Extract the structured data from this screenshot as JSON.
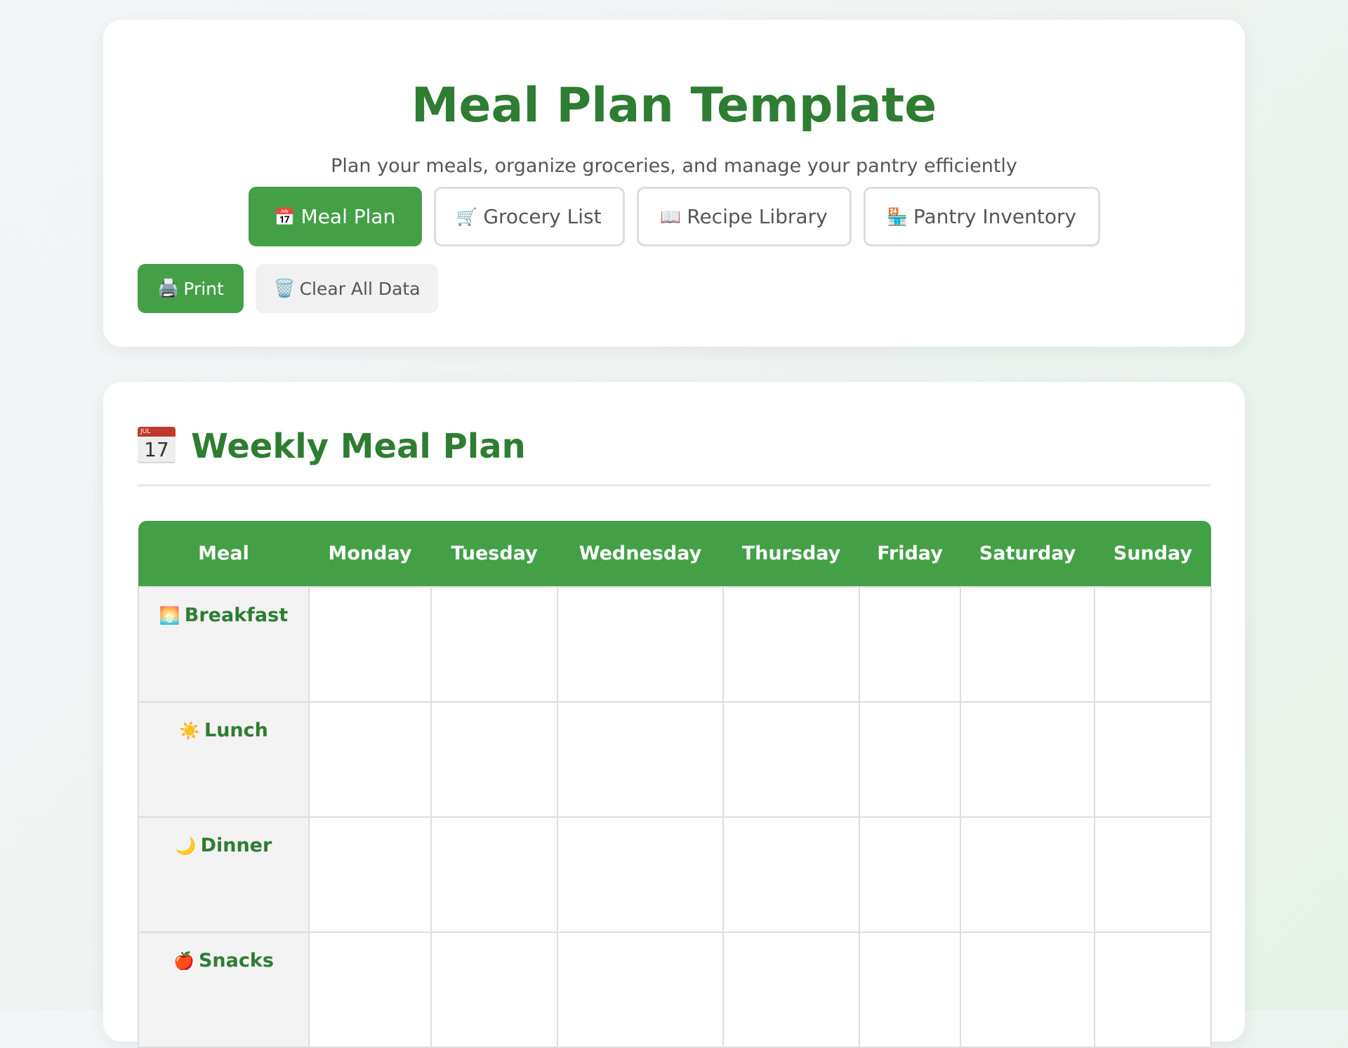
{
  "header": {
    "title": "Meal Plan Template",
    "subtitle": "Plan your meals, organize groceries, and manage your pantry efficiently"
  },
  "tabs": [
    {
      "icon": "calendar-icon",
      "glyph": "📅",
      "label": "Meal Plan",
      "active": true
    },
    {
      "icon": "cart-icon",
      "glyph": "🛒",
      "label": "Grocery List",
      "active": false
    },
    {
      "icon": "book-icon",
      "glyph": "📖",
      "label": "Recipe Library",
      "active": false
    },
    {
      "icon": "pantry-icon",
      "glyph": "🏪",
      "label": "Pantry Inventory",
      "active": false
    }
  ],
  "actions": {
    "print": {
      "icon": "printer-icon",
      "glyph": "🖨️",
      "label": "Print"
    },
    "clear": {
      "icon": "trash-icon",
      "glyph": "🗑️",
      "label": "Clear All Data"
    }
  },
  "meal_plan": {
    "icon": "calendar-icon",
    "calendar_month": "JUL",
    "calendar_day": "17",
    "title": "Weekly Meal Plan",
    "columns": [
      "Meal",
      "Monday",
      "Tuesday",
      "Wednesday",
      "Thursday",
      "Friday",
      "Saturday",
      "Sunday"
    ],
    "rows": [
      {
        "icon": "sunrise-icon",
        "glyph": "🌅",
        "label": "Breakfast"
      },
      {
        "icon": "sun-icon",
        "glyph": "☀️",
        "label": "Lunch"
      },
      {
        "icon": "moon-icon",
        "glyph": "🌙",
        "label": "Dinner"
      },
      {
        "icon": "apple-icon",
        "glyph": "🍎",
        "label": "Snacks"
      }
    ]
  },
  "colors": {
    "accent": "#43a047",
    "title_green": "#2e7d32",
    "border": "#dddddd"
  }
}
